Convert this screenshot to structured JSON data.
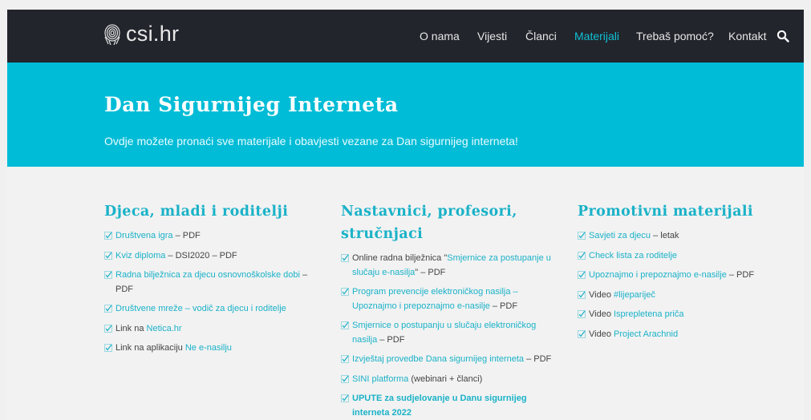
{
  "brand": {
    "name": "csi.hr"
  },
  "nav": {
    "items": [
      {
        "label": "O nama",
        "active": false
      },
      {
        "label": "Vijesti",
        "active": false
      },
      {
        "label": "Članci",
        "active": false
      },
      {
        "label": "Materijali",
        "active": true
      },
      {
        "label": "Trebaš pomoć?",
        "active": false
      },
      {
        "label": "Kontakt",
        "active": false
      }
    ],
    "search_icon": "search-icon"
  },
  "hero": {
    "title": "Dan Sigurnijeg Interneta",
    "subtitle": "Ovdje možete pronaći sve materijale i obavjesti vezane za Dan sigurnijeg interneta!"
  },
  "colors": {
    "topbar": "#23252d",
    "accent": "#00bcd6",
    "link": "#1ab2c8",
    "nav_active": "#0fc0d4"
  },
  "columns": [
    {
      "heading": "Djeca, mladi i roditelji",
      "items": [
        {
          "link": "Društvena igra",
          "after": " – PDF"
        },
        {
          "link": "Kviz diploma",
          "after": " – DSI2020 – PDF"
        },
        {
          "link": "Radna bilježnica za djecu osnovnoškolske dobi",
          "after": " – PDF"
        },
        {
          "link": "Društvene mreže – vodič za djecu i roditelje",
          "after": ""
        },
        {
          "before": "Link na ",
          "link": "Netica.hr",
          "after": ""
        },
        {
          "before": "Link na aplikaciju ",
          "link": "Ne e-nasilju",
          "after": ""
        }
      ]
    },
    {
      "heading_line1": "Nastavnici, profesori,",
      "heading_line2": "stručnjaci",
      "items": [
        {
          "before": "Online radna bilježnica \"",
          "link": "Smjernice za postupanje u slučaju e-nasilja",
          "after": "\" – PDF"
        },
        {
          "link": "Program prevencije elektroničkog nasilja – Upoznajmo i prepoznajmo e-nasilje",
          "after": " – PDF"
        },
        {
          "link": "Smjernice o postupanju u slučaju elektroničkog nasilja",
          "after": " – PDF"
        },
        {
          "link": "Izvještaj provedbe Dana sigurnijeg interneta",
          "after": " – PDF"
        },
        {
          "link": "SINI platforma",
          "after": " (webinari + članci)"
        },
        {
          "strong": "UPUTE za sudjelovanje u Danu sigurnijeg interneta 2022"
        }
      ]
    },
    {
      "heading": "Promotivni materijali",
      "items": [
        {
          "link": "Savjeti za djecu",
          "after": " – letak"
        },
        {
          "link": "Check lista za roditelje",
          "after": ""
        },
        {
          "link": "Upoznajmo i prepoznajmo e-nasilje",
          "after": " – PDF"
        },
        {
          "before": "Video ",
          "link": "#lijepariječ",
          "after": ""
        },
        {
          "before": "Video ",
          "link": "Isprepletena priča",
          "after": ""
        },
        {
          "before": "Video ",
          "link": "Project Arachnid",
          "after": ""
        }
      ]
    }
  ]
}
